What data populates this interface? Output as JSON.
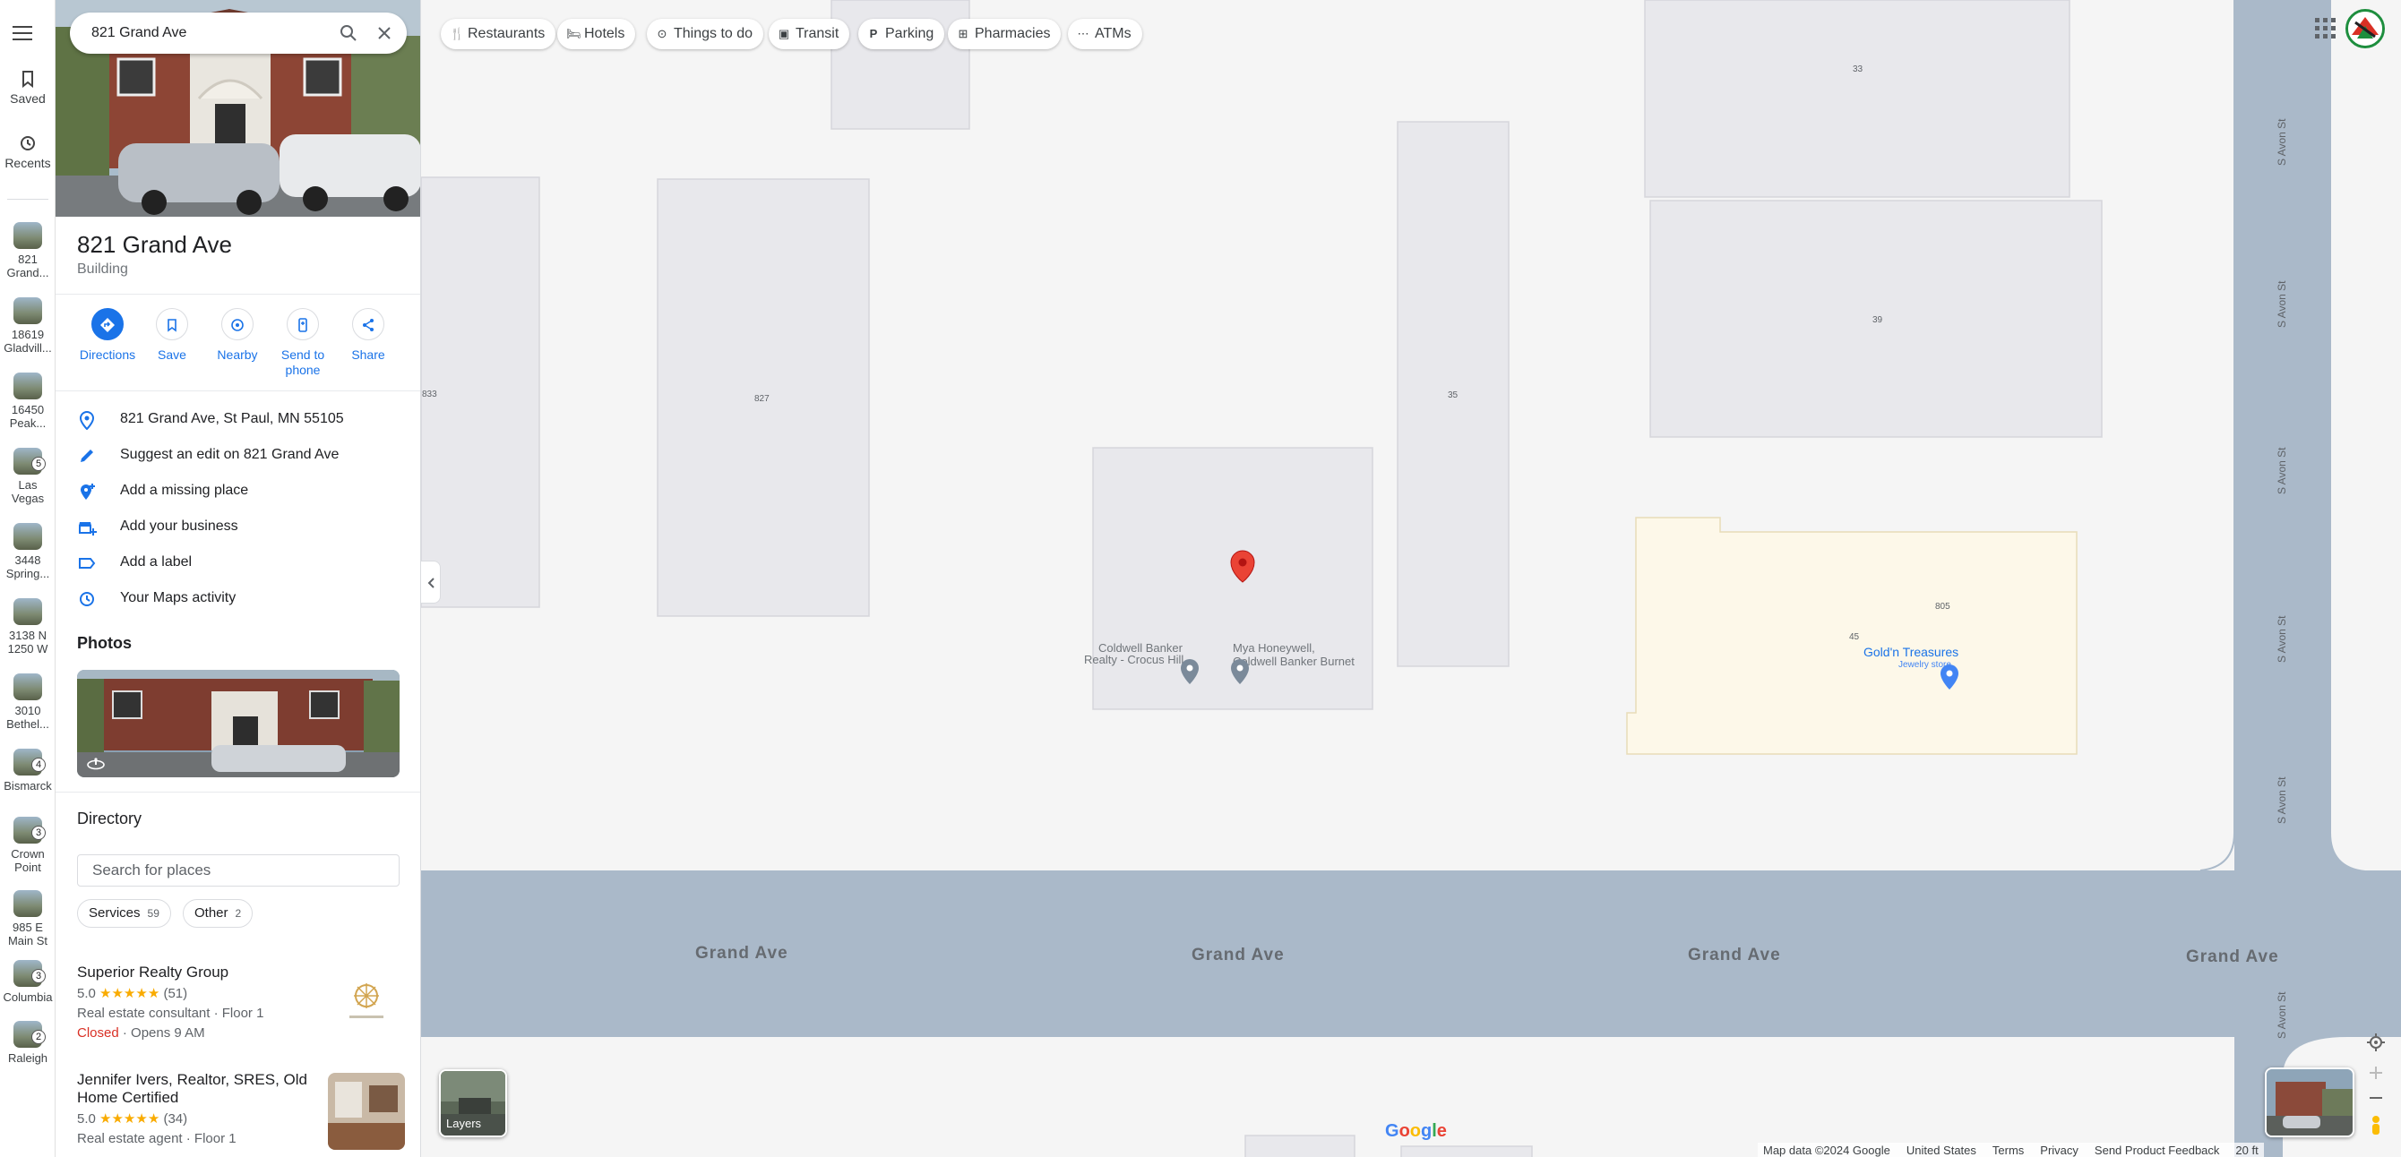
{
  "search": {
    "query": "821 Grand Ave"
  },
  "rail": {
    "saved_label": "Saved",
    "recents_label": "Recents",
    "recent_items": [
      {
        "label": "821 Grand...",
        "badge": ""
      },
      {
        "label": "18619 Gladvill...",
        "badge": ""
      },
      {
        "label": "16450 Peak...",
        "badge": ""
      },
      {
        "label": "Las Vegas",
        "badge": "5"
      },
      {
        "label": "3448 Spring...",
        "badge": ""
      },
      {
        "label": "3138 N 1250 W",
        "badge": ""
      },
      {
        "label": "3010 Bethel...",
        "badge": ""
      },
      {
        "label": "Bismarck",
        "badge": "4"
      },
      {
        "label": "Crown Point",
        "badge": "3"
      },
      {
        "label": "985 E Main St",
        "badge": ""
      },
      {
        "label": "Columbia",
        "badge": "3"
      },
      {
        "label": "Raleigh",
        "badge": "2"
      }
    ]
  },
  "place": {
    "title": "821 Grand Ave",
    "category": "Building",
    "actions": [
      {
        "label": "Directions",
        "icon": "directions-icon"
      },
      {
        "label": "Save",
        "icon": "bookmark-icon"
      },
      {
        "label": "Nearby",
        "icon": "nearby-icon"
      },
      {
        "label": "Send to phone",
        "icon": "send-to-phone-icon"
      },
      {
        "label": "Share",
        "icon": "share-icon"
      }
    ],
    "info": [
      {
        "text": "821 Grand Ave, St Paul, MN 55105",
        "icon": "location-pin-icon"
      },
      {
        "text": "Suggest an edit on 821 Grand Ave",
        "icon": "pencil-icon"
      },
      {
        "text": "Add a missing place",
        "icon": "add-place-icon"
      },
      {
        "text": "Add your business",
        "icon": "add-business-icon"
      },
      {
        "text": "Add a label",
        "icon": "label-icon"
      },
      {
        "text": "Your Maps activity",
        "icon": "history-icon"
      }
    ],
    "photos_heading": "Photos",
    "directory_heading": "Directory",
    "directory_search_placeholder": "Search for places",
    "filters": [
      {
        "label": "Services",
        "count": "59"
      },
      {
        "label": "Other",
        "count": "2"
      }
    ],
    "businesses": [
      {
        "name": "Superior Realty Group",
        "rating": "5.0",
        "stars": "★★★★★",
        "reviews": "(51)",
        "type": "Real estate consultant · Floor 1",
        "status": "Closed",
        "hours": " · Opens 9 AM"
      },
      {
        "name": "Jennifer Ivers, Realtor, SRES, Old Home Certified",
        "rating": "5.0",
        "stars": "★★★★★",
        "reviews": "(34)",
        "type": "Real estate agent · Floor 1"
      }
    ]
  },
  "categories": [
    {
      "label": "Restaurants",
      "icon": "restaurant-icon"
    },
    {
      "label": "Hotels",
      "icon": "hotel-icon"
    },
    {
      "label": "Things to do",
      "icon": "camera-icon"
    },
    {
      "label": "Transit",
      "icon": "transit-icon"
    },
    {
      "label": "Parking",
      "icon": "parking-icon"
    },
    {
      "label": "Pharmacies",
      "icon": "pharmacy-icon"
    },
    {
      "label": "ATMs",
      "icon": "atm-icon"
    }
  ],
  "map": {
    "street_main": "Grand Ave",
    "street_side": "S Avon St",
    "building_numbers": [
      "33",
      "39",
      "35",
      "827",
      "833",
      "805",
      "45"
    ],
    "pois": [
      {
        "name": "Coldwell Banker Realty - Crocus Hill"
      },
      {
        "name": "Mya Honeywell, Coldwell Banker Burnet"
      },
      {
        "name": "Gold'n Treasures",
        "sub": "Jewelry store"
      }
    ],
    "layers_label": "Layers",
    "logo": "Google",
    "footer": {
      "map_data": "Map data ©2024 Google",
      "country": "United States",
      "terms": "Terms",
      "privacy": "Privacy",
      "feedback": "Send Product Feedback",
      "scale": "20 ft"
    },
    "colors": {
      "road": "#aab9c9",
      "building": "#e8e8ec",
      "commercial": "#fdf8e9",
      "pin": "#ea4335",
      "accent": "#1a73e8"
    }
  }
}
